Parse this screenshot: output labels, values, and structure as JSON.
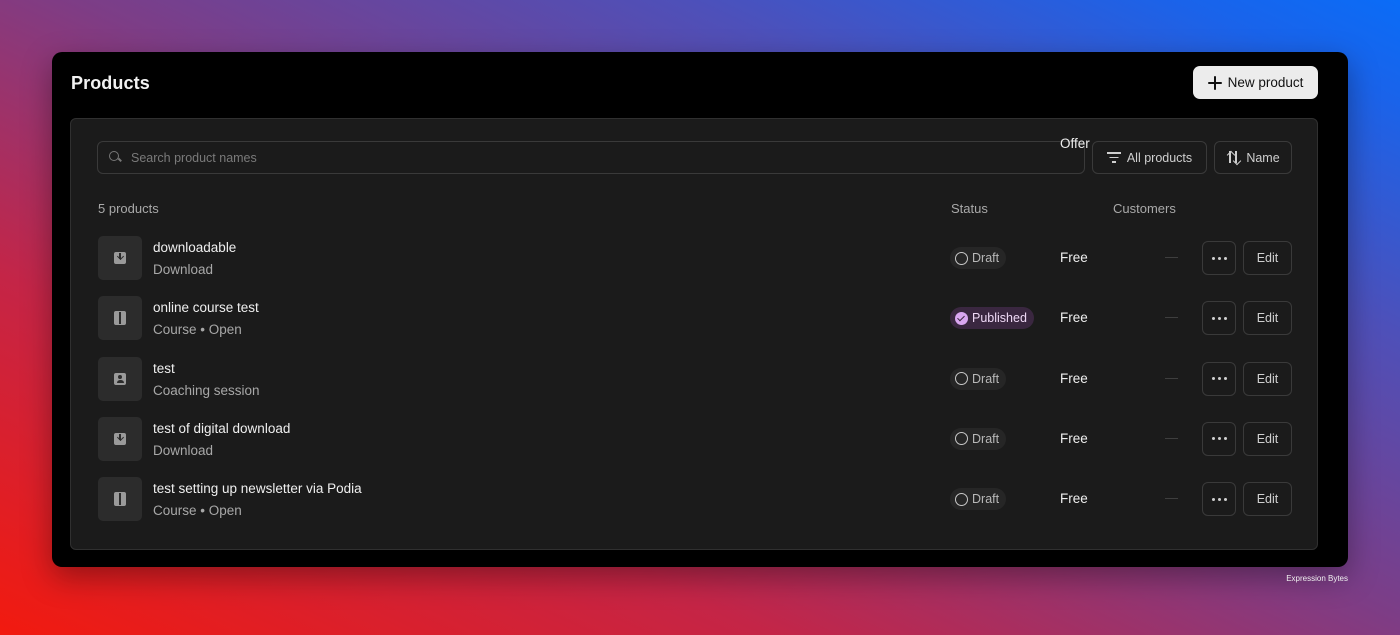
{
  "header": {
    "title": "Products",
    "new_button_label": "New product"
  },
  "toolbar": {
    "search_placeholder": "Search product names",
    "filter_label": "All products",
    "sort_label": "Name"
  },
  "table": {
    "count_label": "5 products",
    "columns": {
      "status": "Status",
      "offer": "Offer",
      "customers": "Customers"
    },
    "rows": [
      {
        "name": "downloadable",
        "subtitle": "Download",
        "icon": "download-icon",
        "status": "Draft",
        "offer": "Free",
        "customers": "—",
        "edit": "Edit"
      },
      {
        "name": "online course test",
        "subtitle": "Course • Open",
        "icon": "course-icon",
        "status": "Published",
        "offer": "Free",
        "customers": "—",
        "edit": "Edit"
      },
      {
        "name": "test",
        "subtitle": "Coaching session",
        "icon": "coaching-icon",
        "status": "Draft",
        "offer": "Free",
        "customers": "—",
        "edit": "Edit"
      },
      {
        "name": "test of digital download",
        "subtitle": "Download",
        "icon": "download-icon",
        "status": "Draft",
        "offer": "Free",
        "customers": "—",
        "edit": "Edit"
      },
      {
        "name": "test setting up newsletter via Podia",
        "subtitle": "Course • Open",
        "icon": "course-icon",
        "status": "Draft",
        "offer": "Free",
        "customers": "—",
        "edit": "Edit"
      }
    ]
  },
  "colors": {
    "published_badge": "#d9a6f0",
    "primary_button": "#ececec",
    "window_bg": "#000000",
    "panel_bg": "#1b1b1b"
  },
  "watermark": "Expression Bytes"
}
